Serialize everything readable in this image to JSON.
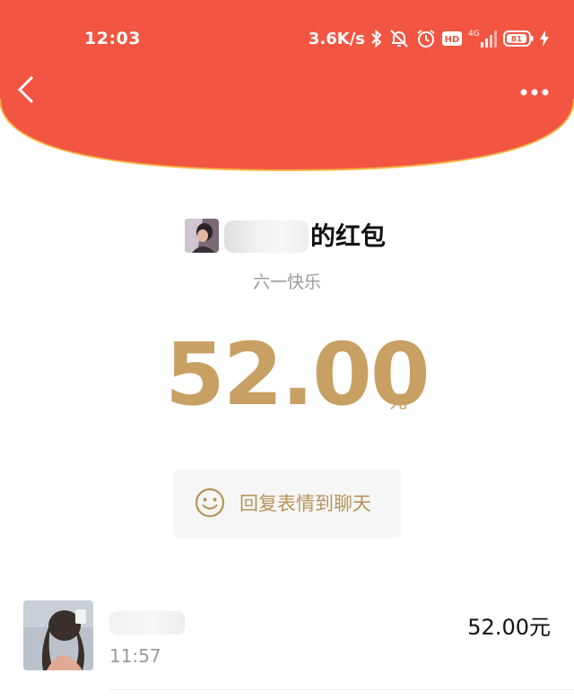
{
  "status_bar": {
    "time": "12:03",
    "net_speed": "3.6K/s",
    "hd_label": "HD",
    "network_label": "4G",
    "battery_level": "81",
    "icons": [
      "bluetooth-icon",
      "mute-icon",
      "alarm-icon",
      "hd-icon",
      "signal-icon",
      "battery-icon",
      "charging-icon"
    ]
  },
  "colors": {
    "header_red": "#f25542",
    "header_edge": "#f5b442",
    "gold": "#c8a063",
    "reply_text": "#b8935a"
  },
  "nav": {
    "back_icon": "chevron-left-icon",
    "more_icon": "more-dots-icon"
  },
  "packet": {
    "sender_title": "的红包",
    "greeting": "六一快乐",
    "amount": "52.00",
    "currency": "元",
    "reply_label": "回复表情到聊天",
    "reply_icon": "smiley-icon"
  },
  "receivers": [
    {
      "time": "11:57",
      "amount": "52.00元"
    }
  ]
}
